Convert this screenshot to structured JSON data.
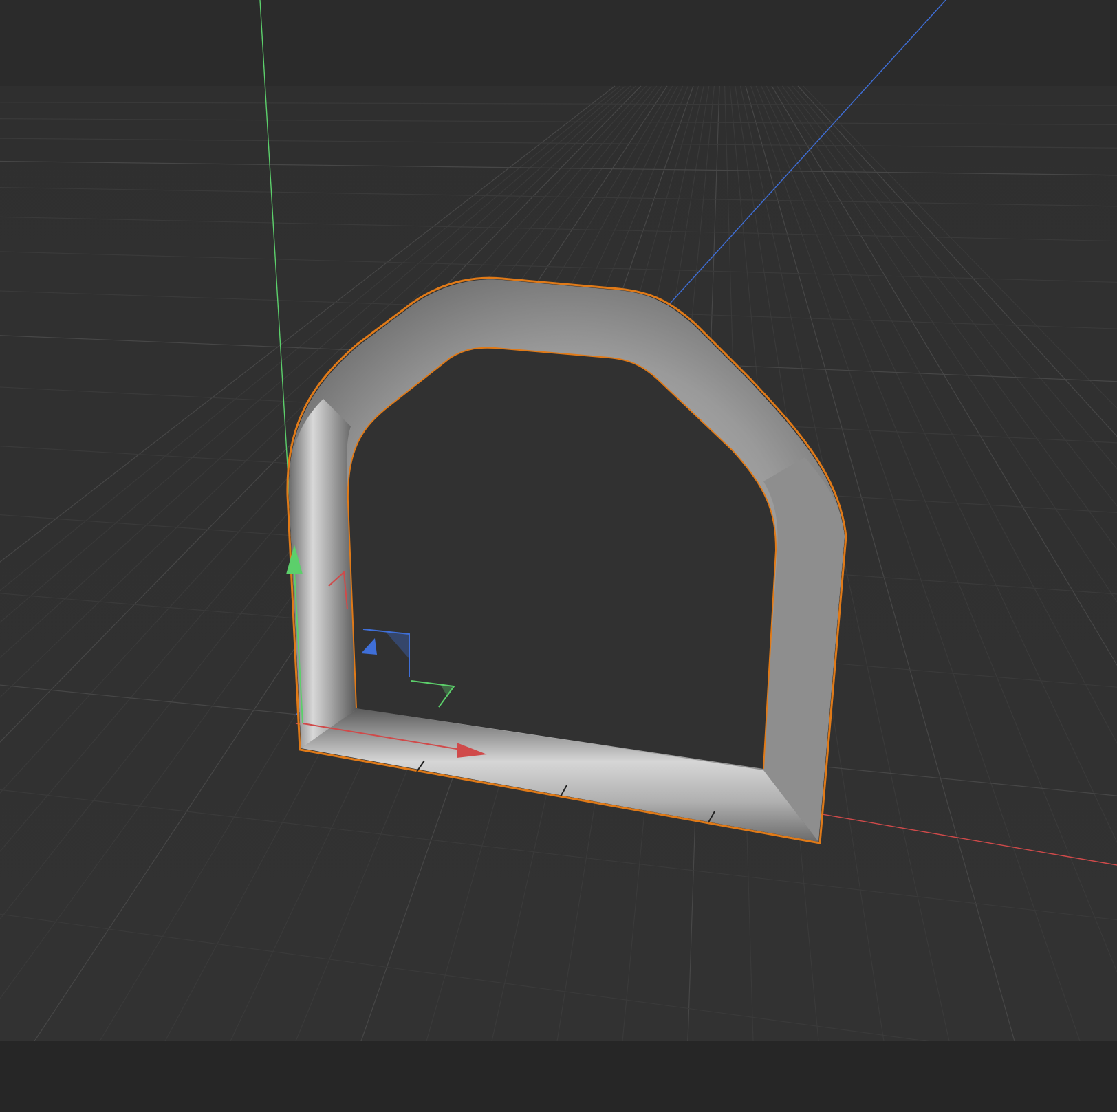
{
  "viewport": {
    "view": "perspective",
    "colors": {
      "background": "#2f2f2f",
      "background_far": "#2b2b2b",
      "grid_line": "#3a3a3a",
      "grid_major": "#474747",
      "axis_x": "#d04a4a",
      "axis_y": "#5ccf6b",
      "axis_z": "#3f6fd8",
      "selection_outline": "#e07a18",
      "object_mid": "#9a9a9a",
      "object_highlight": "#dcdcdc",
      "object_shadow": "#5b5b5b",
      "status_bar": "#262626"
    },
    "object": {
      "type": "sweep tube",
      "shape": "d-ring",
      "selected": true
    },
    "gizmo": {
      "type": "move",
      "axes": [
        "x",
        "y",
        "z"
      ],
      "planes": [
        "xy",
        "yz",
        "xz"
      ]
    }
  }
}
